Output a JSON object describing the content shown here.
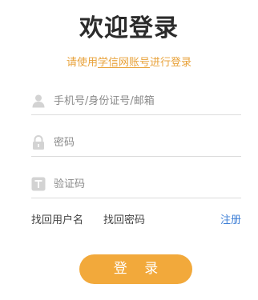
{
  "header": {
    "title": "欢迎登录",
    "subtitle_prefix": "请使用",
    "subtitle_brand": "学信网账号",
    "subtitle_suffix": "进行登录"
  },
  "form": {
    "account": {
      "placeholder": "手机号/身份证号/邮箱",
      "value": "",
      "icon": "user-icon"
    },
    "password": {
      "placeholder": "密码",
      "value": "",
      "icon": "lock-icon"
    },
    "captcha": {
      "placeholder": "验证码",
      "value": "",
      "icon": "text-icon"
    }
  },
  "links": {
    "find_username": "找回用户名",
    "find_password": "找回密码",
    "register": "注册"
  },
  "actions": {
    "login_label": "登 录"
  },
  "colors": {
    "accent": "#f2a93b",
    "subtitle": "#e8a23a",
    "link_blue": "#3e7fd6",
    "icon_gray": "#d3d3d3"
  }
}
